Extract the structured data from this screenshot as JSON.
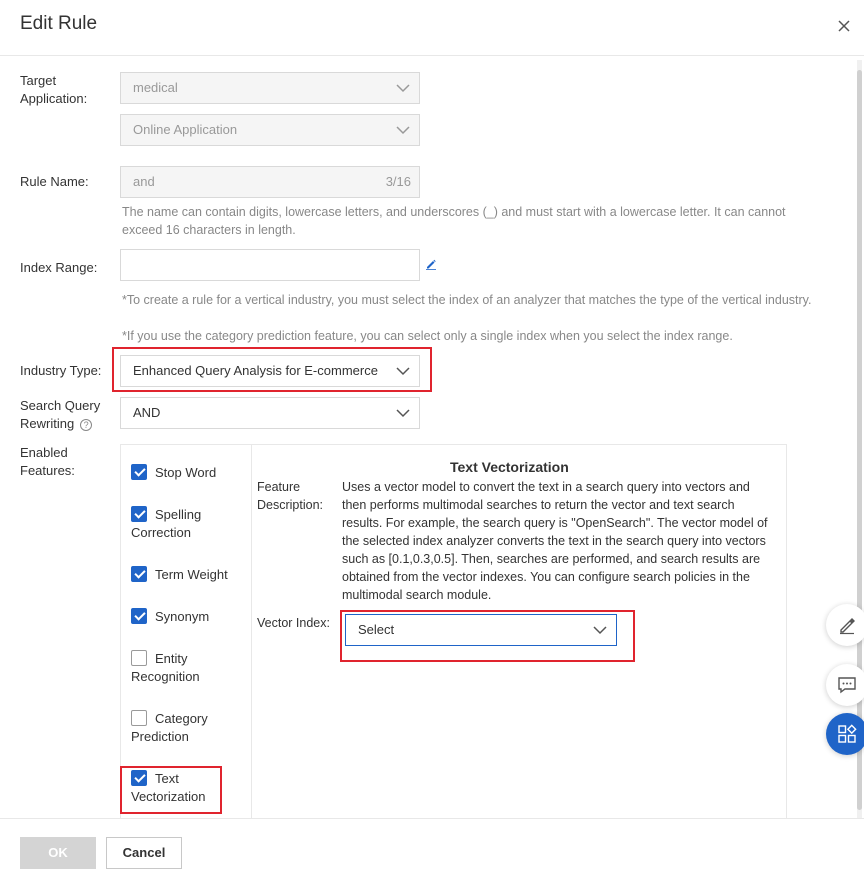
{
  "dialog": {
    "title": "Edit Rule"
  },
  "form": {
    "target_application_label": "Target Application:",
    "target_application_value": "medical",
    "target_application_mode": "Online Application",
    "rule_name_label": "Rule Name:",
    "rule_name_value": "and",
    "rule_name_counter": "3/16",
    "rule_name_help": "The name can contain digits, lowercase letters, and underscores (_) and must start with a lowercase letter. It can cannot exceed 16 characters in length.",
    "index_range_label": "Index Range:",
    "index_range_value": "",
    "index_range_help_1": "*To create a rule for a vertical industry, you must select the index of an analyzer that matches the type of the vertical industry.",
    "index_range_help_2": "*If you use the category prediction feature, you can select only a single index when you select the index range.",
    "industry_type_label": "Industry Type:",
    "industry_type_value": "Enhanced Query Analysis for E-commerce",
    "search_query_label": "Search Query Rewriting",
    "search_query_value": "AND",
    "help_icon": "?",
    "enabled_features_label": "Enabled Features:"
  },
  "features": {
    "items": [
      {
        "label": "Stop Word",
        "checked": true
      },
      {
        "label": "Spelling Correction",
        "checked": true
      },
      {
        "label": "Term Weight",
        "checked": true
      },
      {
        "label": "Synonym",
        "checked": true
      },
      {
        "label": "Entity Recognition",
        "checked": false
      },
      {
        "label": "Category Prediction",
        "checked": false
      },
      {
        "label": "Text Vectorization",
        "checked": true
      }
    ],
    "detail_title": "Text Vectorization",
    "description_label": "Feature Description:",
    "description": "Uses a vector model to convert the text in a search query into vectors and then performs multimodal searches to return the vector and text search results. For example, the search query is \"OpenSearch\". The vector model of the selected index analyzer converts the text in the search query into vectors such as [0.1,0.3,0.5]. Then, searches are performed, and search results are obtained from the vector indexes. You can configure search policies in the multimodal search module.",
    "vector_index_label": "Vector Index:",
    "vector_index_placeholder": "Select"
  },
  "footer": {
    "ok_label": "OK",
    "cancel_label": "Cancel"
  },
  "colors": {
    "accent": "#1f64c8",
    "highlight": "#e0242e"
  },
  "icons": [
    "close-icon",
    "chevron-down-icon",
    "edit-icon",
    "help-icon",
    "checkbox-icon",
    "pencil-icon",
    "chat-icon",
    "apps-icon"
  ]
}
